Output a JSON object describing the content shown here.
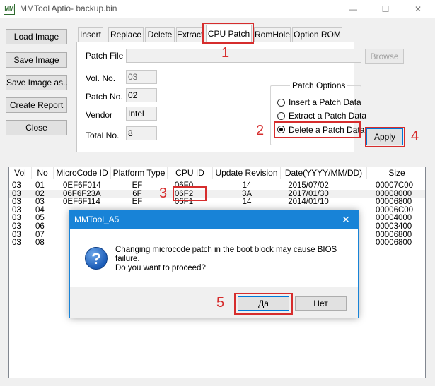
{
  "window": {
    "title": "MMTool Aptio- backup.bin",
    "icon_text": "MM",
    "controls": [
      "—",
      "☐",
      "✕"
    ]
  },
  "left_buttons": [
    "Load Image",
    "Save Image",
    "Save Image as..",
    "Create Report",
    "Close"
  ],
  "tabs": [
    "Insert",
    "Replace",
    "Delete",
    "Extract",
    "CPU Patch",
    "RomHole",
    "Option ROM"
  ],
  "active_tab": "CPU Patch",
  "cpu_patch": {
    "patch_file_label": "Patch File",
    "patch_file_value": "",
    "browse_label": "Browse",
    "vol_no_label": "Vol. No.",
    "vol_no_value": "03",
    "patch_no_label": "Patch No.",
    "patch_no_value": "02",
    "vendor_label": "Vendor",
    "vendor_value": "Intel",
    "total_no_label": "Total No.",
    "total_no_value": "8",
    "options_title": "Patch Options",
    "options": [
      "Insert a Patch Data",
      "Extract a Patch Data",
      "Delete a Patch Data"
    ],
    "selected_option": "Delete a Patch Data",
    "apply_label": "Apply"
  },
  "table": {
    "columns": [
      "Vol",
      "No",
      "MicroCode ID",
      "Platform Type",
      "CPU ID",
      "Update Revision",
      "Date(YYYY/MM/DD)",
      "Size"
    ],
    "rows": [
      [
        "03",
        "01",
        "0EF6F014",
        "EF",
        "06F0",
        "14",
        "2015/07/02",
        "00007C00"
      ],
      [
        "03",
        "02",
        "06F6F23A",
        "6F",
        "06F2",
        "3A",
        "2017/01/30",
        "00008000"
      ],
      [
        "03",
        "03",
        "0EF6F114",
        "EF",
        "06F1",
        "14",
        "2014/01/10",
        "00006800"
      ],
      [
        "03",
        "04",
        "",
        "",
        "",
        "",
        "",
        "00006C00"
      ],
      [
        "03",
        "05",
        "",
        "",
        "",
        "",
        "",
        "00004000"
      ],
      [
        "03",
        "06",
        "",
        "",
        "",
        "",
        "",
        "00003400"
      ],
      [
        "03",
        "07",
        "",
        "",
        "",
        "",
        "",
        "00006800"
      ],
      [
        "03",
        "08",
        "",
        "",
        "",
        "",
        "",
        "00006800"
      ]
    ]
  },
  "dialog": {
    "title": "MMTool_A5",
    "close": "✕",
    "message_line1": "Changing microcode patch in the boot block may cause BIOS",
    "message_line2": "failure.",
    "message_line3": "Do you want to proceed?",
    "yes_label": "Да",
    "no_label": "Нет"
  },
  "annotations": [
    "1",
    "2",
    "3",
    "4",
    "5"
  ],
  "colors": {
    "annotation_red": "#d62d2d",
    "dialog_blue": "#1883d7"
  }
}
